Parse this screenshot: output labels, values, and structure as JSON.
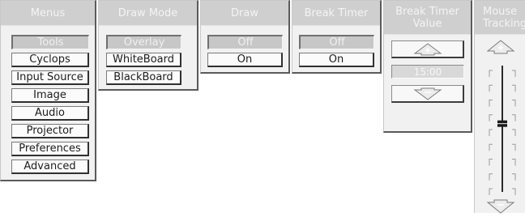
{
  "menus": {
    "header": "Menus",
    "items": [
      {
        "label": "Tools",
        "selected": true
      },
      {
        "label": "Cyclops",
        "selected": false
      },
      {
        "label": "Input Source",
        "selected": false
      },
      {
        "label": "Image",
        "selected": false
      },
      {
        "label": "Audio",
        "selected": false
      },
      {
        "label": "Projector",
        "selected": false
      },
      {
        "label": "Preferences",
        "selected": false
      },
      {
        "label": "Advanced",
        "selected": false
      }
    ]
  },
  "draw_mode": {
    "header": "Draw Mode",
    "items": [
      {
        "label": "Overlay",
        "selected": true
      },
      {
        "label": "WhiteBoard",
        "selected": false
      },
      {
        "label": "BlackBoard",
        "selected": false
      }
    ]
  },
  "draw": {
    "header": "Draw",
    "items": [
      {
        "label": "Off",
        "selected": true
      },
      {
        "label": "On",
        "selected": false
      }
    ]
  },
  "break_timer": {
    "header": "Break Timer",
    "items": [
      {
        "label": "Off",
        "selected": true
      },
      {
        "label": "On",
        "selected": false
      }
    ]
  },
  "break_timer_value": {
    "header_line1": "Break Timer",
    "header_line2": "Value",
    "value": "15:00",
    "increment_icon": "up-arrow-plus-icon",
    "decrement_icon": "down-arrow-minus-icon"
  },
  "mouse_tracking": {
    "header_line1": "Mouse",
    "header_line2": "Tracking",
    "level": 0.55,
    "increment_icon": "up-arrow-plus-icon",
    "decrement_icon": "down-arrow-minus-icon"
  },
  "colors": {
    "header_bg": "#cfcfcf",
    "panel_bg": "#f1f1f1",
    "selected_bg": "#c7c7c7",
    "text": "#1c1c1c"
  }
}
